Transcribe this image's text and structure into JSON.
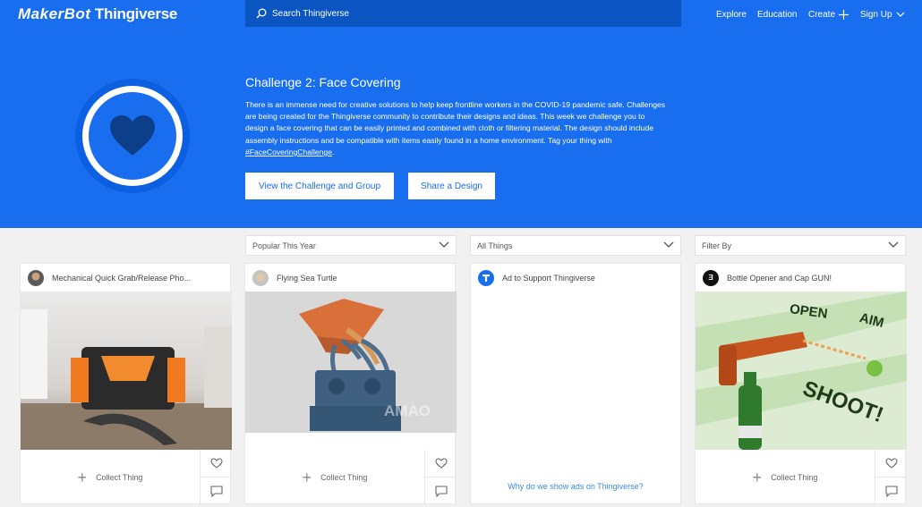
{
  "header": {
    "logo_maker": "MakerBot",
    "logo_thing": "Thingiverse",
    "search_placeholder": "Search Thingiverse",
    "nav": {
      "explore": "Explore",
      "education": "Education",
      "create": "Create",
      "signup": "Sign Up"
    }
  },
  "hero": {
    "title": "Challenge 2: Face Covering",
    "body": "There is an immense need for creative solutions to help keep frontline workers in the COVID-19 pandemic safe. Challenges are being created for the Thingiverse community to contribute their designs and ideas. This week we challenge you to design a face covering that can be easily printed and combined with cloth or filtering material. The design should include assembly instructions and be compatible with items easily found in a home environment. Tag your thing with ",
    "hashtag": "#FaceCoveringChallenge",
    "body_end": ".",
    "btn_challenge": "View the Challenge and Group",
    "btn_share": "Share a Design"
  },
  "filters": {
    "sort": "Popular This Year",
    "type": "All Things",
    "filter": "Filter By"
  },
  "cards": [
    {
      "title": "Mechanical Quick Grab/Release Pho...",
      "collect": "Collect Thing"
    },
    {
      "title": "Flying Sea Turtle",
      "collect": "Collect Thing",
      "watermark": "AMAO"
    },
    {
      "title": "Ad to Support Thingiverse",
      "ad_link": "Why do we show ads on Thingiverse?"
    },
    {
      "title": "Bottle Opener and Cap GUN!",
      "collect": "Collect Thing",
      "art": {
        "open": "OPEN",
        "aim": "AIM",
        "shoot": "SHOOT!"
      }
    }
  ],
  "colors": {
    "brand": "#196ef0",
    "brand_dark": "#0b55c3",
    "link": "#3a8be0"
  }
}
